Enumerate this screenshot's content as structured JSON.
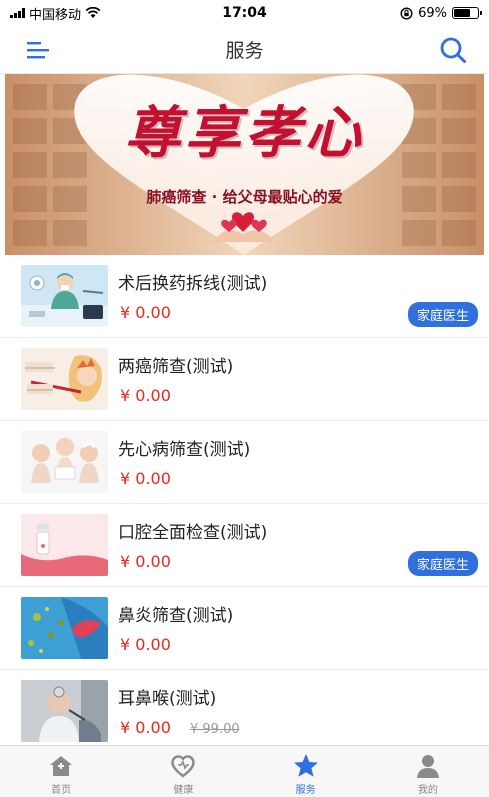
{
  "status_bar": {
    "carrier": "中国移动",
    "time": "17:04",
    "battery": "69%",
    "battery_level": 0.69
  },
  "header": {
    "title": "服务"
  },
  "banner": {
    "headline": "尊享孝心",
    "subtitle": "肺癌筛查 · 给父母最贴心的爱"
  },
  "services": [
    {
      "name": "术后换药拆线(测试)",
      "price": "¥ 0.00",
      "original_price": "",
      "badge": "家庭医生",
      "thumb": "surgery-thumbnail"
    },
    {
      "name": "两癌筛查(测试)",
      "price": "¥ 0.00",
      "original_price": "",
      "badge": "",
      "thumb": "breast-cervical-screening-thumbnail"
    },
    {
      "name": "先心病筛查(测试)",
      "price": "¥ 0.00",
      "original_price": "",
      "badge": "",
      "thumb": "babies-thumbnail"
    },
    {
      "name": "口腔全面检查(测试)",
      "price": "¥ 0.00",
      "original_price": "",
      "badge": "家庭医生",
      "thumb": "tooth-thumbnail"
    },
    {
      "name": "鼻炎筛查(测试)",
      "price": "¥ 0.00",
      "original_price": "",
      "badge": "",
      "thumb": "nasal-cavity-thumbnail"
    },
    {
      "name": "耳鼻喉(测试)",
      "price": "¥ 0.00",
      "original_price": "¥ 99.00",
      "badge": "",
      "thumb": "ent-doctor-thumbnail"
    }
  ],
  "tabbar": {
    "tabs": [
      {
        "label": "首页",
        "icon": "home-icon",
        "active": false
      },
      {
        "label": "健康",
        "icon": "heart-icon",
        "active": false
      },
      {
        "label": "服务",
        "icon": "star-icon",
        "active": true
      },
      {
        "label": "我的",
        "icon": "person-icon",
        "active": false
      }
    ]
  },
  "colors": {
    "accent": "#2f6fde",
    "price": "#e52a1e"
  }
}
